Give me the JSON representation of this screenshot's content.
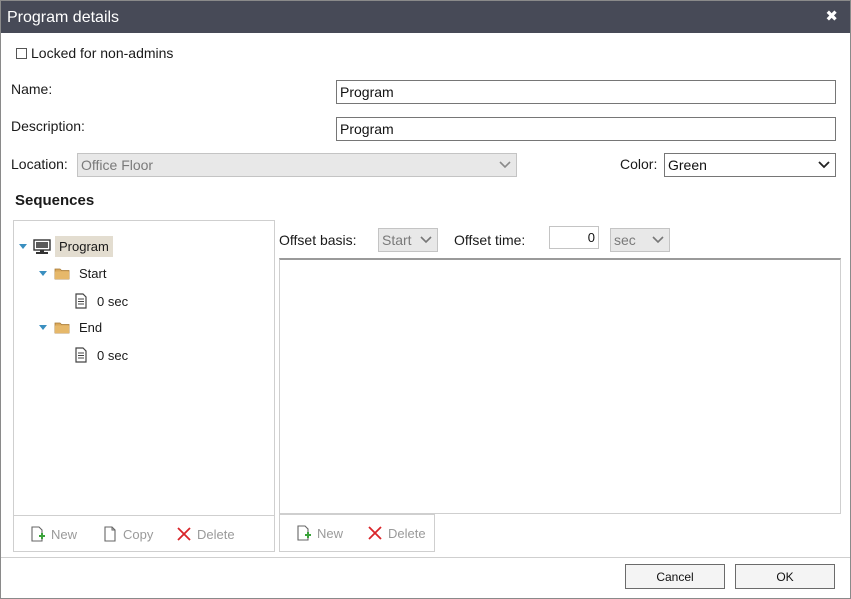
{
  "dialog": {
    "title": "Program details",
    "close_glyph": "✖"
  },
  "locked": {
    "label": "Locked for non-admins",
    "checked": false
  },
  "form": {
    "name_label": "Name:",
    "name_value": "Program",
    "description_label": "Description:",
    "description_value": "Program",
    "location_label": "Location:",
    "location_value": "Office Floor",
    "color_label": "Color:",
    "color_value": "Green"
  },
  "sequences": {
    "title": "Sequences",
    "tree": {
      "root": {
        "label": "Program",
        "icon": "computer-icon"
      },
      "groups": [
        {
          "label": "Start",
          "icon": "folder-icon",
          "child": {
            "label": "0 sec",
            "icon": "document-icon"
          }
        },
        {
          "label": "End",
          "icon": "folder-icon",
          "child": {
            "label": "0 sec",
            "icon": "document-icon"
          }
        }
      ]
    },
    "left_toolbar": {
      "new": "New",
      "copy": "Copy",
      "delete": "Delete"
    },
    "offset": {
      "basis_label": "Offset basis:",
      "basis_value": "Start",
      "time_label": "Offset time:",
      "time_value": "0",
      "unit_value": "sec"
    },
    "right_toolbar": {
      "new": "New",
      "delete": "Delete"
    }
  },
  "footer": {
    "cancel": "Cancel",
    "ok": "OK"
  },
  "colors": {
    "titlebar": "#474a57",
    "tree_selected": "#e3ddd0",
    "expand_arrow": "#3a8fc0",
    "delete_red": "#d9252a",
    "folder": "#d9a85b"
  }
}
